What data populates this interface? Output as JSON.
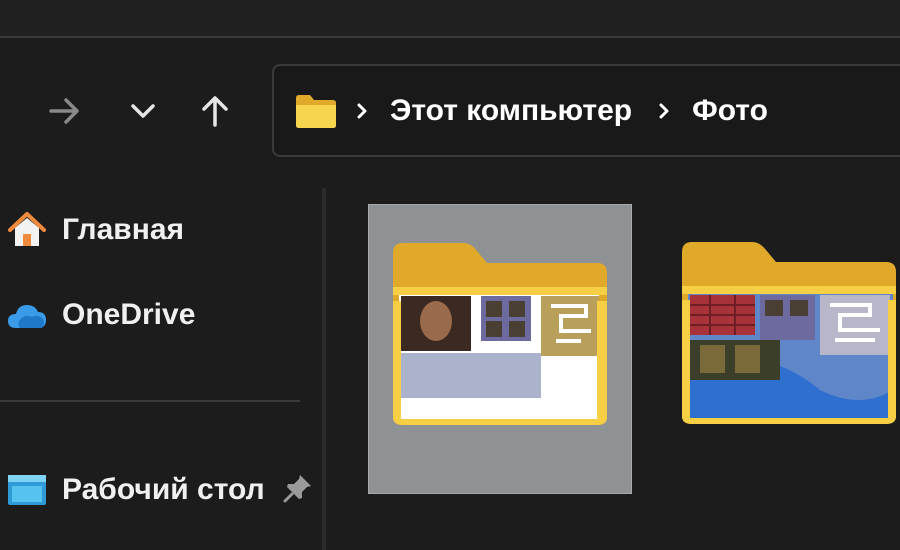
{
  "navigation": {
    "forward_icon": "arrow-right-icon",
    "recent_icon": "chevron-down-icon",
    "up_icon": "arrow-up-icon"
  },
  "address_bar": {
    "folder_icon": "folder-icon",
    "separator_icon": "chevron-right-icon",
    "crumbs": [
      "Этот компьютер",
      "Фото"
    ]
  },
  "sidebar": {
    "items": [
      {
        "label": "Главная",
        "icon": "home-icon"
      },
      {
        "label": "OneDrive",
        "icon": "cloud-icon"
      },
      {
        "label": "Рабочий стол",
        "icon": "desktop-icon",
        "pinned": true
      }
    ],
    "pin_icon": "pin-icon"
  },
  "content": {
    "items": [
      {
        "type": "folder",
        "selected": true,
        "icon": "folder-thumbnail-icon"
      },
      {
        "type": "folder",
        "selected": false,
        "icon": "folder-thumbnail-icon"
      }
    ]
  },
  "colors": {
    "background": "#1c1c1c",
    "folder_yellow": "#f6cf45",
    "selection": "#8e9294",
    "onedrive_blue": "#3a9be8",
    "home_orange": "#f08a3c"
  }
}
